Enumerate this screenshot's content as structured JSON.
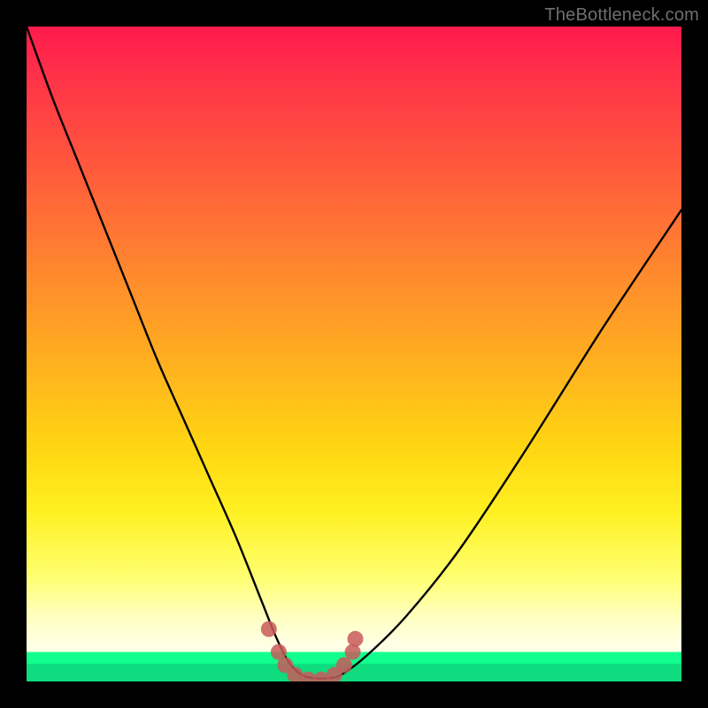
{
  "watermark": "TheBottleneck.com",
  "colors": {
    "curve": "#000000",
    "marker_stroke": "#c85a5a",
    "marker_fill": "#c85a5a",
    "frame": "#000000"
  },
  "chart_data": {
    "type": "line",
    "title": "",
    "xlabel": "",
    "ylabel": "",
    "xlim": [
      0,
      100
    ],
    "ylim": [
      0,
      100
    ],
    "grid": false,
    "legend": null,
    "series": [
      {
        "name": "bottleneck-curve",
        "x": [
          0,
          4,
          8,
          12,
          16,
          20,
          24,
          28,
          32,
          36,
          38,
          40,
          42,
          44,
          46,
          48,
          52,
          58,
          66,
          76,
          88,
          100
        ],
        "y": [
          100,
          89,
          79,
          69,
          59,
          49,
          40,
          31,
          22,
          12,
          7,
          3,
          1,
          0.5,
          0.5,
          1,
          4,
          10,
          20,
          35,
          54,
          72
        ]
      }
    ],
    "markers": {
      "name": "bottom-dots",
      "points": [
        {
          "x": 37.0,
          "y": 8.0
        },
        {
          "x": 38.5,
          "y": 4.5
        },
        {
          "x": 39.5,
          "y": 2.5
        },
        {
          "x": 41.0,
          "y": 1.0
        },
        {
          "x": 43.0,
          "y": 0.3
        },
        {
          "x": 45.0,
          "y": 0.3
        },
        {
          "x": 47.0,
          "y": 1.0
        },
        {
          "x": 48.5,
          "y": 2.5
        },
        {
          "x": 49.8,
          "y": 4.5
        },
        {
          "x": 50.2,
          "y": 6.5
        }
      ],
      "radius_px": 9
    }
  }
}
